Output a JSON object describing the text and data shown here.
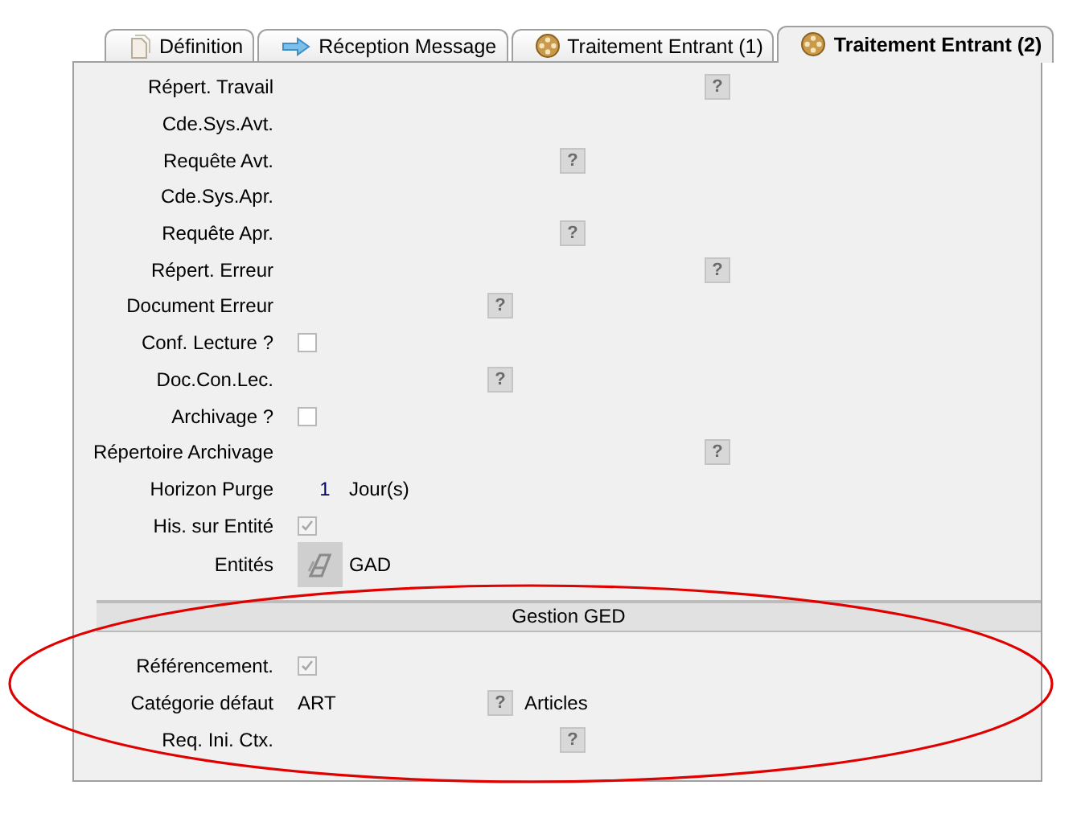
{
  "tabs": [
    {
      "label": "Définition",
      "selected": false
    },
    {
      "label": "Réception Message",
      "selected": false
    },
    {
      "label": "Traitement Entrant (1)",
      "selected": false
    },
    {
      "label": "Traitement Entrant (2)",
      "selected": true
    }
  ],
  "lookup_glyph": "?",
  "rows": [
    {
      "label": "Répert. Travail",
      "kind": "folder"
    },
    {
      "label": "Cde.Sys.Avt.",
      "kind": "blank"
    },
    {
      "label": "Requête Avt.",
      "kind": "query"
    },
    {
      "label": "Cde.Sys.Apr.",
      "kind": "blank"
    },
    {
      "label": "Requête Apr.",
      "kind": "query"
    },
    {
      "label": "Répert. Erreur",
      "kind": "folder"
    },
    {
      "label": "Document Erreur",
      "kind": "document"
    },
    {
      "label": "Conf. Lecture ?",
      "kind": "checkbox",
      "checked": false
    },
    {
      "label": "Doc.Con.Lec.",
      "kind": "document"
    },
    {
      "label": "Archivage ?",
      "kind": "checkbox",
      "checked": false
    },
    {
      "label": "Répertoire Archivage",
      "kind": "folder"
    },
    {
      "label": "Horizon Purge",
      "kind": "number",
      "value": "1",
      "unit": "Jour(s)"
    },
    {
      "label": "His. sur Entité",
      "kind": "checkbox",
      "checked": true
    },
    {
      "label": "Entités",
      "kind": "picker",
      "value": "GAD"
    }
  ],
  "section": {
    "title": "Gestion GED",
    "rows": [
      {
        "label": "Référencement.",
        "kind": "checkbox",
        "checked": true
      },
      {
        "label": "Catégorie défaut",
        "kind": "document",
        "value": "ART",
        "description": "Articles"
      },
      {
        "label": "Req. Ini. Ctx.",
        "kind": "query"
      }
    ]
  },
  "highlight": {
    "kind": "ellipse",
    "color": "#e00000"
  }
}
